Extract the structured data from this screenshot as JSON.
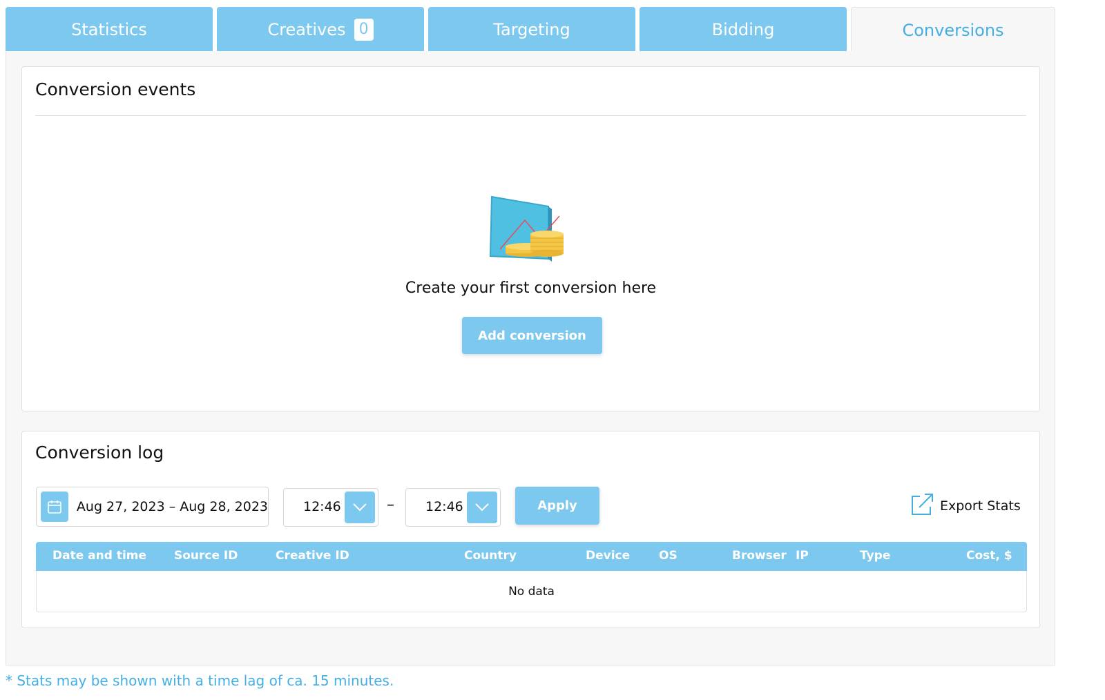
{
  "tabs": [
    {
      "label": "Statistics"
    },
    {
      "label": "Creatives",
      "badge": "0"
    },
    {
      "label": "Targeting"
    },
    {
      "label": "Bidding"
    },
    {
      "label": "Conversions",
      "active": true
    }
  ],
  "conversion_events": {
    "title": "Conversion events",
    "empty_text": "Create your first conversion here",
    "add_button": "Add conversion"
  },
  "conversion_log": {
    "title": "Conversion log",
    "date_range": "Aug 27, 2023 – Aug 28, 2023",
    "time_start": "12:46",
    "time_separator": "–",
    "time_end": "12:46",
    "apply_button": "Apply",
    "export_label": "Export Stats",
    "columns": [
      "Date and time",
      "Source ID",
      "Creative ID",
      "Country",
      "Device",
      "OS",
      "Browser",
      "IP",
      "Type",
      "Cost, $"
    ],
    "empty_row": "No data"
  },
  "footnote": "* Stats may be shown with a time lag of ca. 15 minutes.",
  "colors": {
    "accent": "#7dc8ef",
    "active_tab_text": "#45aee3",
    "panel_bg": "#f7f7f7"
  },
  "icons": {
    "calendar": "calendar-icon",
    "dropdown": "chevron-down-icon",
    "export": "external-link-icon",
    "illustration": "chart-coins-illustration"
  }
}
